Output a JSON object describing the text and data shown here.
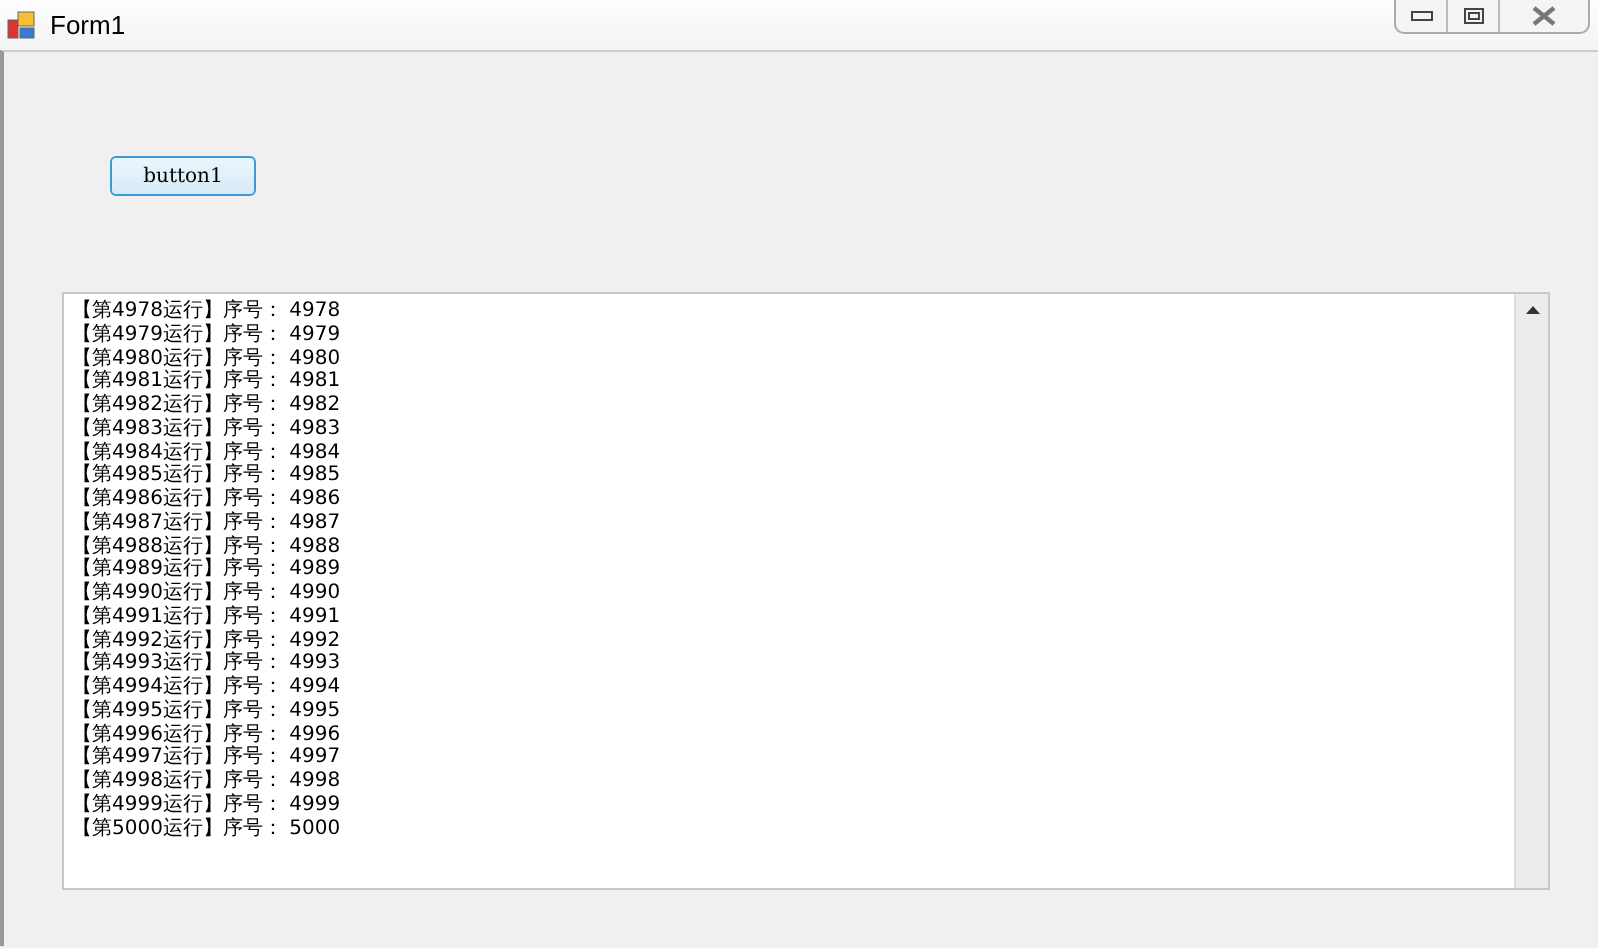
{
  "window": {
    "title": "Form1"
  },
  "button": {
    "label": "button1"
  },
  "output_lines": [
    "【第4978运行】序号： 4978",
    "【第4979运行】序号： 4979",
    "【第4980运行】序号： 4980",
    "【第4981运行】序号： 4981",
    "【第4982运行】序号： 4982",
    "【第4983运行】序号： 4983",
    "【第4984运行】序号： 4984",
    "【第4985运行】序号： 4985",
    "【第4986运行】序号： 4986",
    "【第4987运行】序号： 4987",
    "【第4988运行】序号： 4988",
    "【第4989运行】序号： 4989",
    "【第4990运行】序号： 4990",
    "【第4991运行】序号： 4991",
    "【第4992运行】序号： 4992",
    "【第4993运行】序号： 4993",
    "【第4994运行】序号： 4994",
    "【第4995运行】序号： 4995",
    "【第4996运行】序号： 4996",
    "【第4997运行】序号： 4997",
    "【第4998运行】序号： 4998",
    "【第4999运行】序号： 4999",
    "【第5000运行】序号： 5000"
  ]
}
